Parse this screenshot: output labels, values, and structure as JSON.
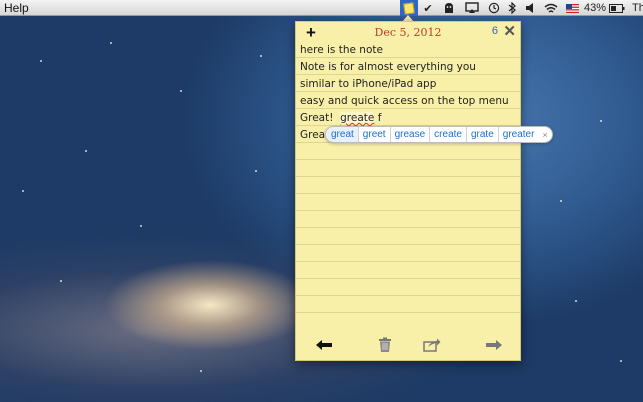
{
  "menubar": {
    "help_label": "Help",
    "battery_percent": "43%",
    "clock_fragment": "Th",
    "icons": [
      "notes-app-icon",
      "checkmark-icon",
      "cat-icon",
      "airplay-icon",
      "time-machine-icon",
      "bluetooth-icon",
      "volume-icon",
      "wifi-icon",
      "flag-icon",
      "battery-icon"
    ]
  },
  "note": {
    "date": "Dec 5, 2012",
    "count": "6",
    "add_symbol": "+",
    "close_symbol": "✕",
    "lines": [
      "here is the note",
      "Note is for almost everything you",
      "similar to iPhone/iPad app",
      "easy and quick access on the top menu"
    ],
    "line5_prefix": "Great!  ",
    "line5_word": "greate",
    "line5_suffix": " f",
    "line6_prefix": "Great!"
  },
  "suggestions": {
    "items": [
      "great",
      "greet",
      "grease",
      "create",
      "grate",
      "greater"
    ],
    "close_symbol": "×"
  },
  "colors": {
    "note_paper": "#f8f0a8",
    "date_red": "#c0392b",
    "link_blue": "#1f6fc8"
  }
}
